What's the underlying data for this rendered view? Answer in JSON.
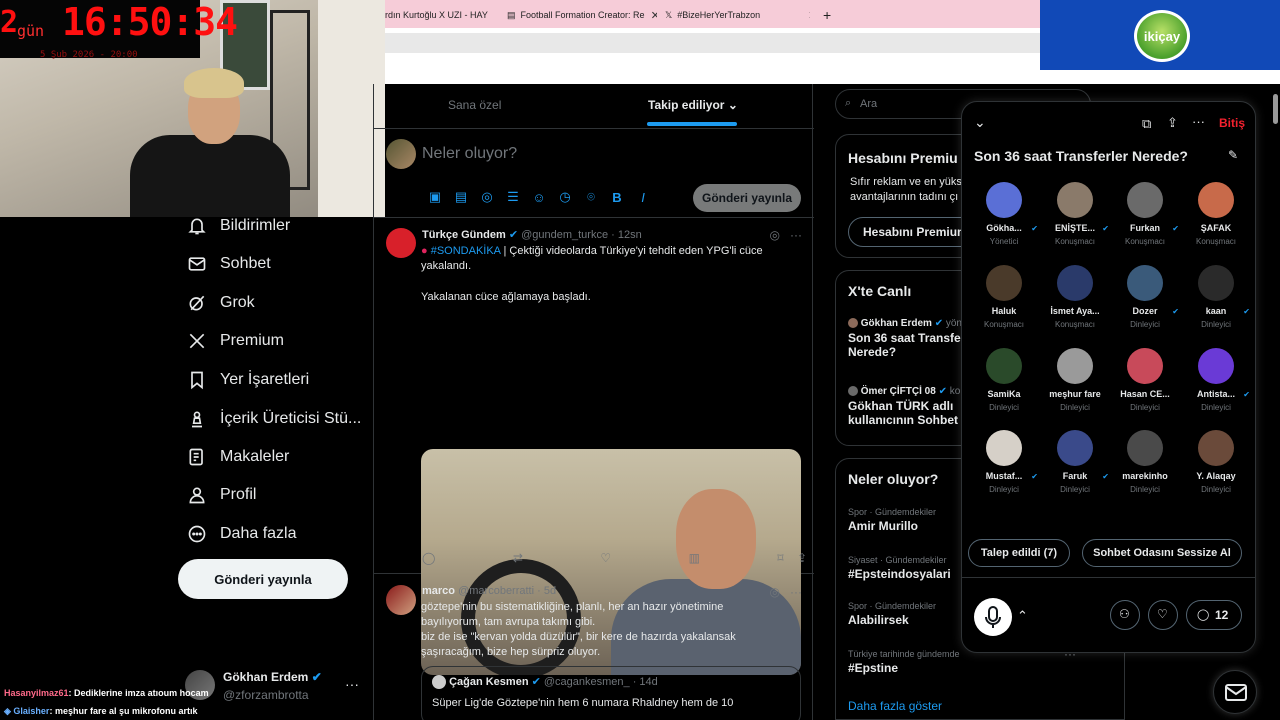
{
  "stream_overlay": {
    "days": "2",
    "days_label": "gün",
    "clock": "16:50:34",
    "date": "5 Şub 2026 - 20:00"
  },
  "browser": {
    "tabs": [
      {
        "label": "rdın Kurtoğlu X UZI - HAY"
      },
      {
        "label": "Football Formation Creator: Re"
      },
      {
        "label": "#BizeHerYerTrabzon"
      }
    ],
    "new_tab": "+"
  },
  "ad": {
    "brand": "ikiçay"
  },
  "nav": {
    "items": [
      {
        "label": "Bildirimler",
        "icon": "bell-icon"
      },
      {
        "label": "Sohbet",
        "icon": "mail-icon"
      },
      {
        "label": "Grok",
        "icon": "grok-icon"
      },
      {
        "label": "Premium",
        "icon": "x-logo-icon"
      },
      {
        "label": "Yer İşaretleri",
        "icon": "bookmark-icon"
      },
      {
        "label": "İçerik Üreticisi Stü...",
        "icon": "creator-studio-icon"
      },
      {
        "label": "Makaleler",
        "icon": "articles-icon"
      },
      {
        "label": "Profil",
        "icon": "person-icon"
      },
      {
        "label": "Daha fazla",
        "icon": "more-circle-icon"
      }
    ],
    "post_button": "Gönderi yayınla"
  },
  "account": {
    "name": "Gökhan Erdem",
    "handle": "@zforzambrotta",
    "more": "···"
  },
  "chat": [
    {
      "user": "Hasanyilmaz61",
      "text": ": Dediklerine imza atıoum hocam",
      "color": "#ff6a8a"
    },
    {
      "user": "Glaisher",
      "text": ": meşhur fare al şu mikrofonu artık",
      "color": "#6ab0ff"
    }
  ],
  "feed": {
    "tabs": [
      "Sana özel",
      "Takip ediliyor"
    ],
    "compose": {
      "placeholder": "Neler oluyor?",
      "button": "Gönderi yayınla"
    },
    "tweets": [
      {
        "name": "Türkçe Gündem",
        "handle": "@gundem_turkce · 12sn",
        "hashtag": "#SONDAKİKA",
        "text1": " | Çektiği videolarda Türkiye'yi tehdit eden YPG'li cüce yakalandı.",
        "text2": "Yakalanan cüce ağlamaya başladı."
      },
      {
        "name": "marco",
        "handle": "@marcoberratti · 5d",
        "lines": [
          "göztepe'nin bu sistematikliğine, planlı, her an hazır yönetimine",
          "bayılıyorum, tam avrupa takımı gibi.",
          "biz de ise \"kervan yolda düzülür\", bir kere de hazırda yakalansak",
          "şaşıracağım, bize hep sürpriz oluyor."
        ],
        "quote": {
          "name": "Çağan Kesmen",
          "handle": "@cagankesmen_ · 14d",
          "text": "Süper Lig'de Göztepe'nin hem 6 numara Rhaldney hem de 10"
        }
      }
    ]
  },
  "sidebar": {
    "search_placeholder": "Ara",
    "premium": {
      "title": "Hesabını Premiu",
      "desc1": "Sıfır reklam ve en yüks",
      "desc2": "avantajlarının tadını çı",
      "button": "Hesabını Premium"
    },
    "live": {
      "title": "X'te Canlı",
      "items": [
        {
          "host": "Gökhan Erdem",
          "extra": "yön",
          "title1": "Son 36 saat Transferle",
          "title2": "Nerede?"
        },
        {
          "host": "Ömer ÇİFTÇİ 08",
          "extra": "kon",
          "title1": "Gökhan TÜRK adlı",
          "title2": "kullanıcının Sohbet O"
        }
      ]
    },
    "trends": {
      "title": "Neler oluyor?",
      "items": [
        {
          "cat": "Spor · Gündemdekiler",
          "name": "Amir Murillo"
        },
        {
          "cat": "Siyaset · Gündemdekiler",
          "name": "#Epsteindosyalari"
        },
        {
          "cat": "Spor · Gündemdekiler",
          "name": "Alabilirsek"
        },
        {
          "cat": "Türkiye tarihinde gündemde",
          "name": "#Epstine"
        }
      ],
      "show_more": "Daha fazla göster"
    }
  },
  "space": {
    "end": "Bitiş",
    "title": "Son 36 saat Transferler Nerede?",
    "participants": [
      {
        "name": "Gökha...",
        "role": "Yönetici",
        "verified": true,
        "color": "#5a6fd6"
      },
      {
        "name": "ENİŞTE...",
        "role": "Konuşmacı",
        "verified": true,
        "color": "#8a7a6a"
      },
      {
        "name": "Furkan",
        "role": "Konuşmacı",
        "verified": true,
        "color": "#6a6a6a"
      },
      {
        "name": "ŞAFAK",
        "role": "Konuşmacı",
        "verified": false,
        "color": "#c86a4a"
      },
      {
        "name": "Haluk",
        "role": "Konuşmacı",
        "verified": false,
        "color": "#4a3a2a"
      },
      {
        "name": "İsmet Aya...",
        "role": "Konuşmacı",
        "verified": false,
        "color": "#2a3a6a"
      },
      {
        "name": "Dozer",
        "role": "Dinleyici",
        "verified": true,
        "color": "#3a5a7a"
      },
      {
        "name": "kaan",
        "role": "Dinleyici",
        "verified": true,
        "color": "#2a2a2a"
      },
      {
        "name": "SamiKa",
        "role": "Dinleyici",
        "verified": false,
        "color": "#2a4a2a"
      },
      {
        "name": "meşhur fare",
        "role": "Dinleyici",
        "verified": false,
        "color": "#9a9a9a"
      },
      {
        "name": "Hasan CE...",
        "role": "Dinleyici",
        "verified": false,
        "color": "#c84a5a"
      },
      {
        "name": "Antista...",
        "role": "Dinleyici",
        "verified": true,
        "color": "#6a3ad6"
      },
      {
        "name": "Mustaf...",
        "role": "Dinleyici",
        "verified": true,
        "color": "#d6d0c8"
      },
      {
        "name": "Faruk",
        "role": "Dinleyici",
        "verified": true,
        "color": "#3a4a8a"
      },
      {
        "name": "marekinho",
        "role": "Dinleyici",
        "verified": false,
        "color": "#4a4a4a"
      },
      {
        "name": "Y. Alaqay",
        "role": "Dinleyici",
        "verified": false,
        "color": "#6a4a3a"
      }
    ],
    "requests_button": "Talep edildi (7)",
    "mute_button": "Sohbet Odasını Sessize Al",
    "comment_count": "12"
  }
}
